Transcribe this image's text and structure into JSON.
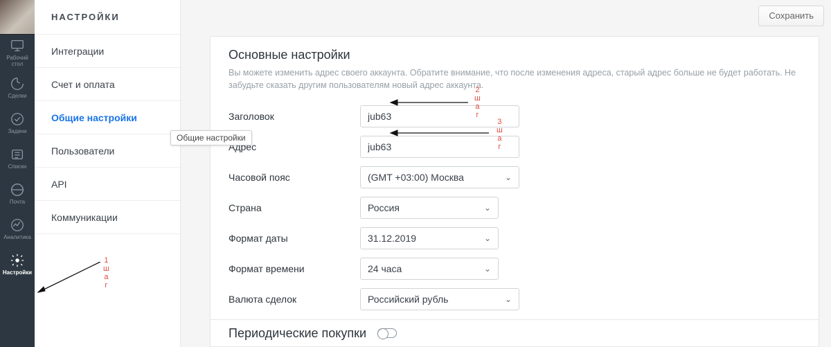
{
  "rail": {
    "items": [
      {
        "label": "Рабочий\nстол"
      },
      {
        "label": "Сделки"
      },
      {
        "label": "Задачи"
      },
      {
        "label": "Списки"
      },
      {
        "label": "Почта"
      },
      {
        "label": "Аналитика"
      },
      {
        "label": "Настройки"
      }
    ]
  },
  "sidebar": {
    "title": "НАСТРОЙКИ",
    "items": [
      {
        "label": "Интеграции"
      },
      {
        "label": "Счет и оплата"
      },
      {
        "label": "Общие настройки",
        "active": true
      },
      {
        "label": "Пользователи"
      },
      {
        "label": "API"
      },
      {
        "label": "Коммуникации"
      }
    ]
  },
  "tooltip": "Общие настройки",
  "save_label": "Сохранить",
  "section": {
    "title": "Основные настройки",
    "desc": "Вы можете изменить адрес своего аккаунта. Обратите внимание, что после изменения адреса, старый адрес больше не будет работать. Не забудьте сказать другим пользователям новый адрес аккаунта.",
    "fields": {
      "title_label": "Заголовок",
      "title_value": "jub63",
      "address_label": "Адрес",
      "address_value": "jub63",
      "tz_label": "Часовой пояс",
      "tz_value": "(GMT +03:00) Москва",
      "country_label": "Страна",
      "country_value": "Россия",
      "date_label": "Формат даты",
      "date_value": "31.12.2019",
      "time_label": "Формат времени",
      "time_value": "24 часа",
      "currency_label": "Валюта сделок",
      "currency_value": "Российский рубль"
    }
  },
  "sub_section_title": "Периодические покупки",
  "annotations": {
    "step1": "1\nш\nа\nг",
    "step2": "2\nш\nа\nг",
    "step3": "3\nш\nа\nг"
  }
}
